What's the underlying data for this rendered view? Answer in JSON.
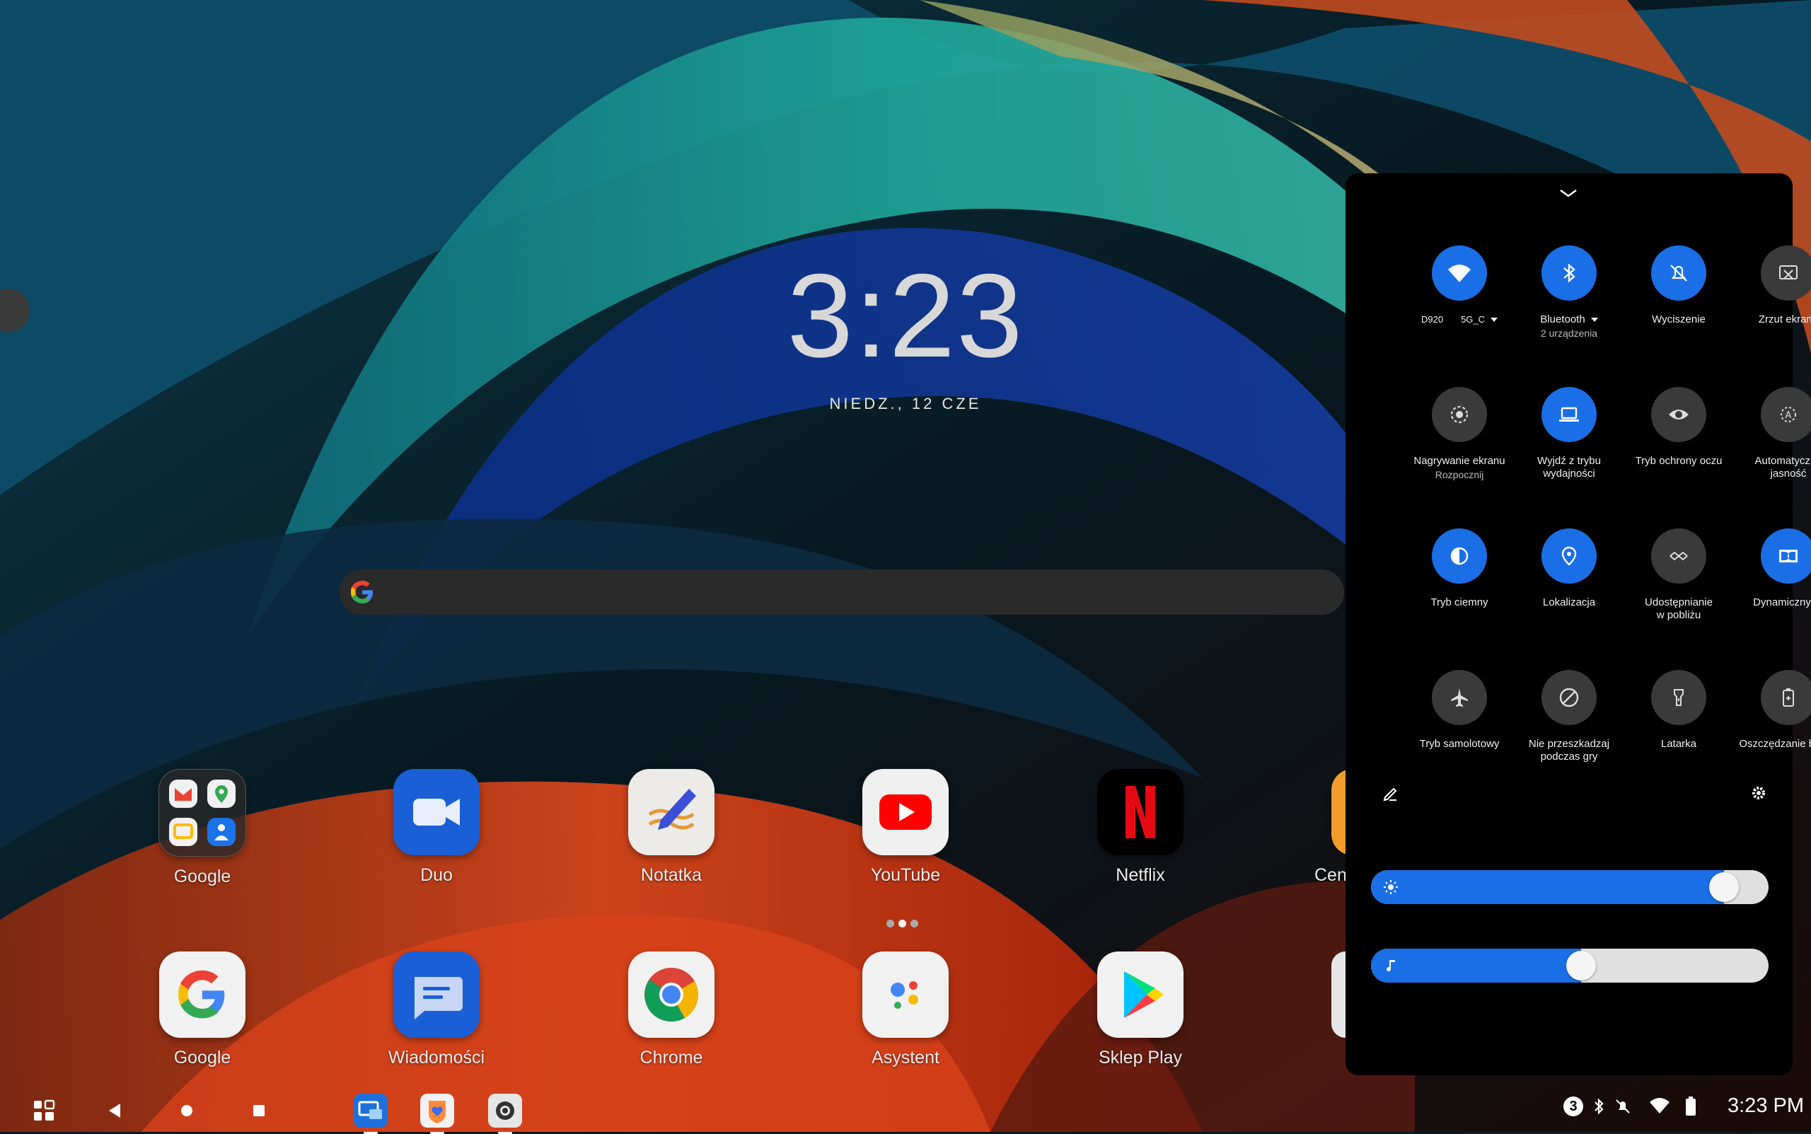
{
  "homescreen": {
    "clock": "3:23",
    "date": "NIEDZ., 12 CZE",
    "apps_row1": [
      {
        "label": "Google",
        "icon": "google-folder-icon"
      },
      {
        "label": "Duo",
        "icon": "duo-icon"
      },
      {
        "label": "Notatka",
        "icon": "notatka-icon"
      },
      {
        "label": "YouTube",
        "icon": "youtube-icon"
      },
      {
        "label": "Netflix",
        "icon": "netflix-icon"
      },
      {
        "label": "Cent",
        "icon": "partial-app-icon"
      }
    ],
    "apps_row2": [
      {
        "label": "Google",
        "icon": "google-icon"
      },
      {
        "label": "Wiadomości",
        "icon": "messages-icon"
      },
      {
        "label": "Chrome",
        "icon": "chrome-icon"
      },
      {
        "label": "Asystent",
        "icon": "assistant-icon"
      },
      {
        "label": "Sklep Play",
        "icon": "play-store-icon"
      }
    ]
  },
  "taskbar": {
    "time": "3:23 PM",
    "notification_count": "3"
  },
  "quick_settings": {
    "tiles": [
      {
        "name": "D920",
        "name2": "5G_C",
        "sub": "",
        "state": "on",
        "icon": "wifi-icon",
        "caret": true
      },
      {
        "name": "Bluetooth",
        "sub": "2 urządzenia",
        "state": "on",
        "icon": "bluetooth-icon",
        "caret": true
      },
      {
        "name": "Wyciszenie",
        "sub": "",
        "state": "on",
        "icon": "mute-icon"
      },
      {
        "name": "Zrzut ekranu",
        "sub": "",
        "state": "off",
        "icon": "screenshot-icon"
      },
      {
        "name": "Nagrywanie ekranu",
        "sub": "Rozpocznij",
        "state": "off",
        "icon": "screen-record-icon"
      },
      {
        "name": "Wyjdź z trybu wydajności",
        "sub": "",
        "state": "on",
        "icon": "laptop-icon"
      },
      {
        "name": "Tryb ochrony oczu",
        "sub": "",
        "state": "off",
        "icon": "eye-icon"
      },
      {
        "name": "Automatyczna jasność",
        "sub": "",
        "state": "off",
        "icon": "auto-brightness-icon"
      },
      {
        "name": "Tryb ciemny",
        "sub": "",
        "state": "on",
        "icon": "dark-mode-icon"
      },
      {
        "name": "Lokalizacja",
        "sub": "",
        "state": "on",
        "icon": "location-icon"
      },
      {
        "name": "Udostępnianie w pobliżu",
        "sub": "",
        "state": "off",
        "icon": "nearby-share-icon"
      },
      {
        "name": "Dynamiczny",
        "sub": "",
        "state": "on",
        "icon": "dolby-icon",
        "caret": true
      },
      {
        "name": "Tryb samolotowy",
        "sub": "",
        "state": "off",
        "icon": "airplane-icon"
      },
      {
        "name": "Nie przeszkadzaj podczas gry",
        "sub": "",
        "state": "off",
        "icon": "do-not-disturb-icon"
      },
      {
        "name": "Latarka",
        "sub": "",
        "state": "off",
        "icon": "flashlight-icon"
      },
      {
        "name": "Oszczędzanie baterii",
        "sub": "",
        "state": "off",
        "icon": "battery-saver-icon"
      }
    ],
    "brightness_level": 0.92,
    "volume_level": 0.53,
    "colors": {
      "accent": "#1a6fe6",
      "off": "#3a3a3a"
    }
  }
}
